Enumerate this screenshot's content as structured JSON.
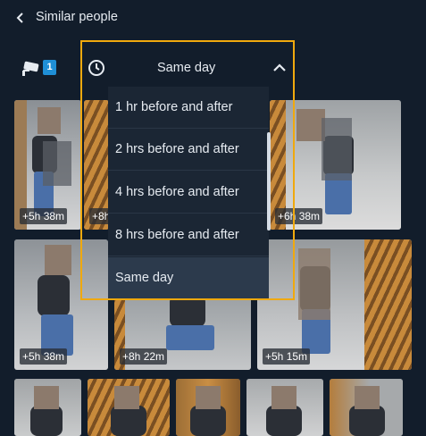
{
  "header": {
    "title": "Similar people"
  },
  "camera": {
    "count": "1"
  },
  "time_filter": {
    "selected": "Same day",
    "options": [
      "1 hr before and after",
      "2 hrs before and after",
      "4 hrs before and after",
      "8 hrs before and after",
      "Same day"
    ]
  },
  "thumbnails": {
    "row1": [
      "+5h 38m",
      "+8h",
      "+6h 38m"
    ],
    "row2": [
      "+5h 38m",
      "+8h 22m",
      "+5h 15m"
    ]
  },
  "colors": {
    "highlight": "#f0a90e",
    "badge_blue": "#1f8fd6",
    "background": "#121d2b"
  }
}
